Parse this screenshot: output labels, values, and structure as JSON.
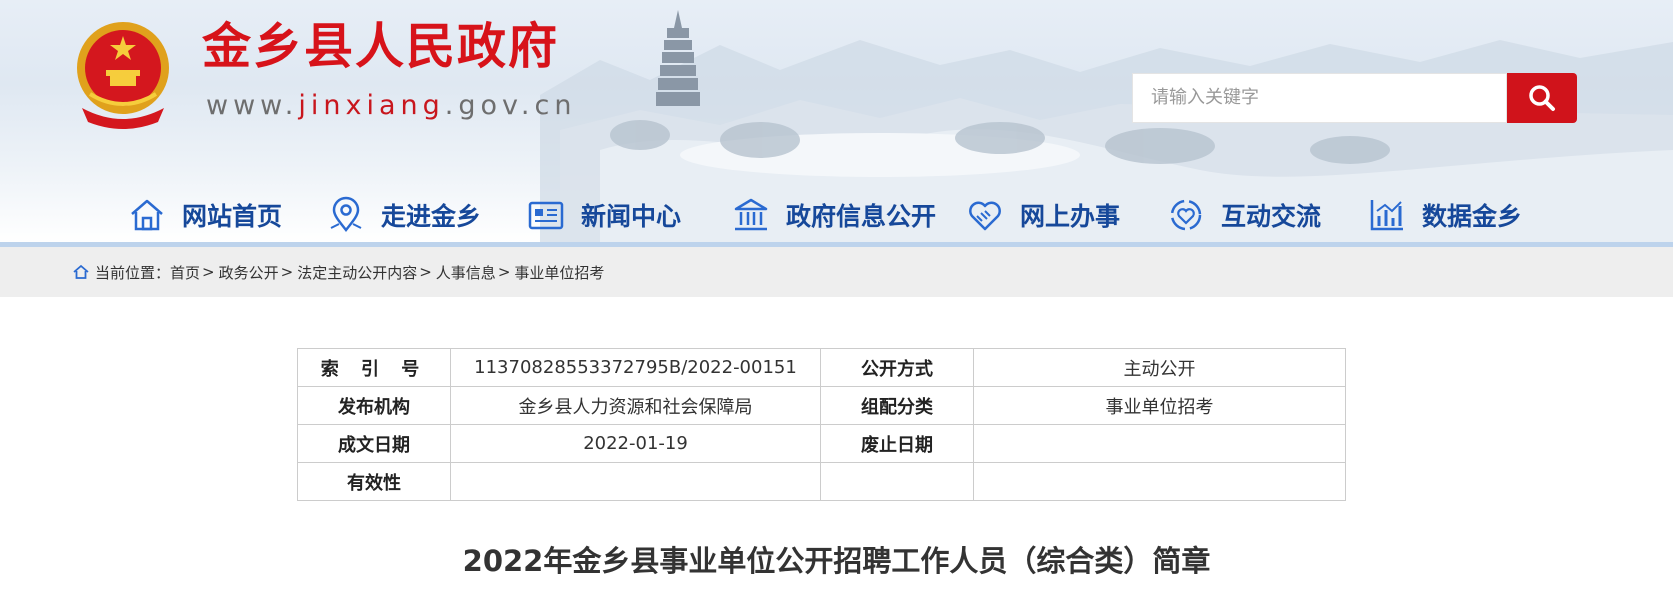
{
  "header": {
    "site_title": "金乡县人民政府",
    "site_url_pre": "www.",
    "site_url_mid": "jinxiang",
    "site_url_post": ".gov.cn",
    "emblem_icon": "national-emblem-icon"
  },
  "search": {
    "placeholder": "请输入关键字",
    "button_icon": "search-icon"
  },
  "nav": {
    "items": [
      {
        "label": "网站首页",
        "icon": "home-icon"
      },
      {
        "label": "走进金乡",
        "icon": "location-pin-icon"
      },
      {
        "label": "新闻中心",
        "icon": "newspaper-icon"
      },
      {
        "label": "政府信息公开",
        "icon": "government-building-icon"
      },
      {
        "label": "网上办事",
        "icon": "handshake-heart-icon"
      },
      {
        "label": "互动交流",
        "icon": "interaction-icon"
      },
      {
        "label": "数据金乡",
        "icon": "bar-chart-icon"
      }
    ]
  },
  "breadcrumb": {
    "prefix": "当前位置：",
    "items": [
      "首页",
      "政务公开",
      "法定主动公开内容",
      "人事信息",
      "事业单位招考"
    ]
  },
  "info_table": {
    "rows": [
      {
        "k1": "索 引 号",
        "v1": "11370828553372795B/2022-00151",
        "k2": "公开方式",
        "v2": "主动公开"
      },
      {
        "k1": "发布机构",
        "v1": "金乡县人力资源和社会保障局",
        "k2": "组配分类",
        "v2": "事业单位招考"
      },
      {
        "k1": "成文日期",
        "v1": "2022-01-19",
        "k2": "废止日期",
        "v2": ""
      },
      {
        "k1": "有效性",
        "v1": "",
        "k2": "",
        "v2": ""
      }
    ]
  },
  "document": {
    "title": "2022年金乡县事业单位公开招聘工作人员（综合类）简章"
  },
  "colors": {
    "brand_red": "#d0131b",
    "nav_blue": "#16489a",
    "nav_line": "#bdd3ec",
    "crumb_bg": "#eeeeee"
  }
}
